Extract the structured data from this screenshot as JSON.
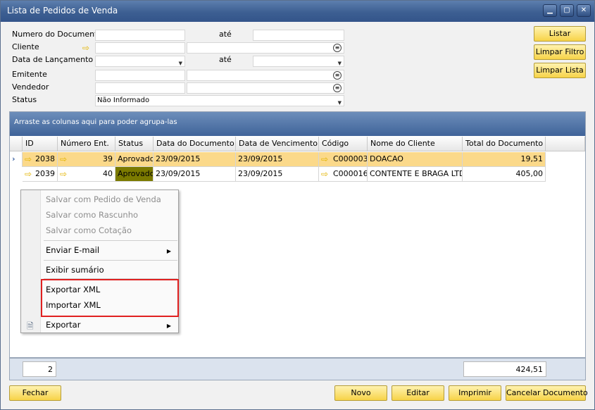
{
  "window": {
    "title": "Lista de Pedidos de Venda",
    "minimize": "▁",
    "maximize": "▢",
    "close": "✕"
  },
  "filters": {
    "numero_doc_label": "Numero do Documento",
    "ate1_label": "até",
    "numero_doc_from": "",
    "numero_doc_to": "",
    "cliente_label": "Cliente",
    "cliente_code": "",
    "cliente_name": "",
    "data_lanc_label": "Data de Lançamento",
    "ate2_label": "até",
    "data_from": "",
    "data_to": "",
    "emitente_label": "Emitente",
    "emitente_code": "",
    "emitente_name": "",
    "vendedor_label": "Vendedor",
    "vendedor_code": "",
    "vendedor_name": "",
    "status_label": "Status",
    "status_value": "Não Informado"
  },
  "side_buttons": {
    "listar": "Listar",
    "limpar_filtro": "Limpar Filtro",
    "limpar_lista": "Limpar Lista"
  },
  "grid": {
    "group_hint": "Arraste as colunas aqui para poder agrupa-las",
    "columns": [
      "ID",
      "Número Ent.",
      "Status",
      "Data do Documento",
      "Data de Vencimento",
      "Código",
      "Nome do Cliente",
      "Total do Documento"
    ],
    "rows": [
      {
        "id": "2038",
        "num_ent": "39",
        "status": "Aprovado",
        "data_doc": "23/09/2015",
        "data_venc": "23/09/2015",
        "codigo": "C000003",
        "nome": "DOACAO",
        "total": "19,51"
      },
      {
        "id": "2039",
        "num_ent": "40",
        "status": "Aprovado",
        "data_doc": "23/09/2015",
        "data_venc": "23/09/2015",
        "codigo": "C000016",
        "nome": "CONTENTE E BRAGA LTDA",
        "total": "405,00"
      }
    ],
    "footer_count": "2",
    "footer_total": "424,51"
  },
  "context_menu": {
    "salvar_pedido": "Salvar com Pedido de Venda",
    "salvar_rascunho": "Salvar como Rascunho",
    "salvar_cotacao": "Salvar como Cotação",
    "enviar_email": "Enviar E-mail",
    "exibir_sumario": "Exibir sumário",
    "exportar_xml": "Exportar XML",
    "importar_xml": "Importar XML",
    "exportar": "Exportar"
  },
  "bottom_buttons": {
    "fechar": "Fechar",
    "novo": "Novo",
    "editar": "Editar",
    "imprimir": "Imprimir",
    "cancelar": "Cancelar Documento"
  }
}
